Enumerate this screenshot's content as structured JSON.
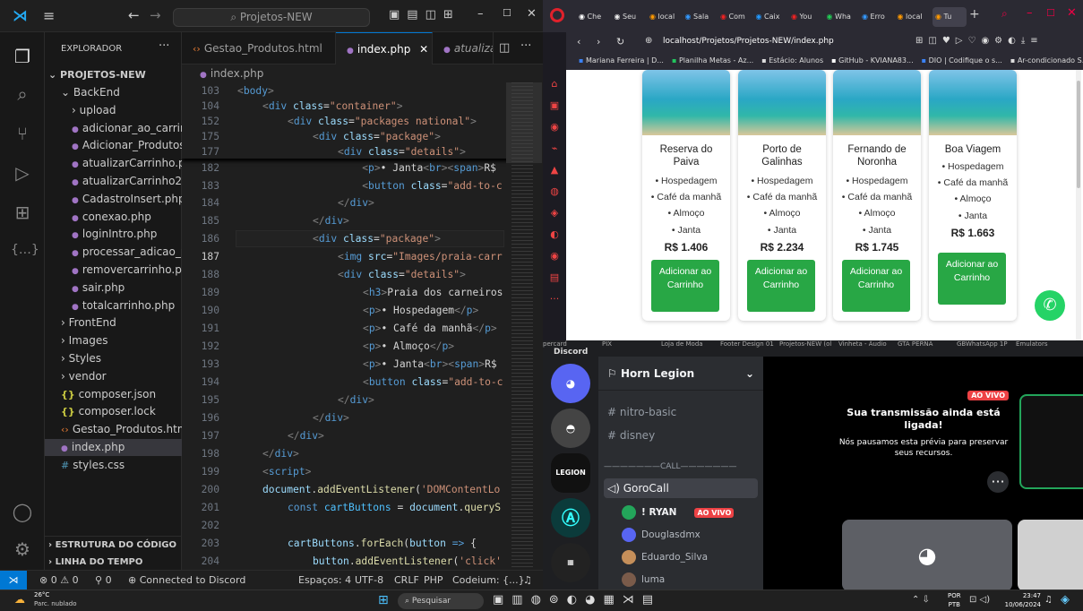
{
  "vscode": {
    "search": "Projetos-NEW",
    "explorer_title": "EXPLORADOR",
    "project": "PROJETOS-NEW",
    "tree": [
      {
        "label": "BackEnd",
        "type": "folder-open",
        "indent": 1
      },
      {
        "label": "upload",
        "type": "folder",
        "indent": 2
      },
      {
        "label": "adicionar_ao_carrinh...",
        "type": "php",
        "indent": 2
      },
      {
        "label": "Adicionar_Produtos....",
        "type": "php",
        "indent": 2
      },
      {
        "label": "atualizarCarrinho.php",
        "type": "php",
        "indent": 2
      },
      {
        "label": "atualizarCarrinho2.p...",
        "type": "php",
        "indent": 2
      },
      {
        "label": "CadastroInsert.php",
        "type": "php",
        "indent": 2
      },
      {
        "label": "conexao.php",
        "type": "php",
        "indent": 2
      },
      {
        "label": "loginIntro.php",
        "type": "php",
        "indent": 2
      },
      {
        "label": "processar_adicao_pr...",
        "type": "php",
        "indent": 2
      },
      {
        "label": "removercarrinho.php",
        "type": "php",
        "indent": 2
      },
      {
        "label": "sair.php",
        "type": "php",
        "indent": 2
      },
      {
        "label": "totalcarrinho.php",
        "type": "php",
        "indent": 2
      },
      {
        "label": "FrontEnd",
        "type": "folder",
        "indent": 1
      },
      {
        "label": "Images",
        "type": "folder",
        "indent": 1
      },
      {
        "label": "Styles",
        "type": "folder",
        "indent": 1
      },
      {
        "label": "vendor",
        "type": "folder",
        "indent": 1
      },
      {
        "label": "composer.json",
        "type": "json",
        "indent": 1
      },
      {
        "label": "composer.lock",
        "type": "json",
        "indent": 1
      },
      {
        "label": "Gestao_Produtos.html",
        "type": "html",
        "indent": 1
      },
      {
        "label": "index.php",
        "type": "php",
        "indent": 1,
        "selected": true
      },
      {
        "label": "styles.css",
        "type": "css",
        "indent": 1
      }
    ],
    "outline": "ESTRUTURA DO CÓDIGO",
    "timeline": "LINHA DO TEMPO",
    "tabs": [
      "Gestao_Produtos.html",
      "index.php",
      "atualiza"
    ],
    "breadcrumb": "index.php",
    "status": {
      "errors": "0",
      "warnings": "0",
      "ports": "0",
      "discord": "Connected to Discord",
      "spaces": "Espaços: 4",
      "encoding": "UTF-8",
      "eol": "CRLF",
      "lang": "PHP",
      "codeium": "Codeium: {...}"
    }
  },
  "browser": {
    "tabs": [
      "Che",
      "Seu",
      "local",
      "Sala",
      "Com",
      "Caix",
      "You",
      "Wha",
      "Erro",
      "local",
      "Tu"
    ],
    "url": "localhost/Projetos/Projetos-NEW/index.php",
    "bookmarks": [
      "Mariana Ferreira | D...",
      "Planilha Metas - Az...",
      "Estácio: Alunos",
      "GitHub - KVIANA83...",
      "DIO | Codifique o s...",
      "Ar-condicionado S..."
    ],
    "cards": [
      {
        "title": "Reserva do Paiva",
        "items": [
          "• Hospedagem",
          "• Café da manhã",
          "• Almoço",
          "• Janta"
        ],
        "price": "R$ 1.406",
        "button": "Adicionar ao Carrinho"
      },
      {
        "title": "Porto de Galinhas",
        "items": [
          "• Hospedagem",
          "• Café da manhã",
          "• Almoço",
          "• Janta"
        ],
        "price": "R$ 2.234",
        "button": "Adicionar ao Carrinho"
      },
      {
        "title": "Fernando de Noronha",
        "items": [
          "• Hospedagem",
          "• Café da manhã",
          "• Almoço",
          "• Janta"
        ],
        "price": "R$ 1.745",
        "button": "Adicionar ao Carrinho"
      },
      {
        "title": "Boa Viagem",
        "items": [
          "• Hospedagem",
          "• Café da manhã",
          "• Almoço",
          "• Janta"
        ],
        "price": "R$ 1.663",
        "button": "Adicionar ao Carrinho"
      }
    ]
  },
  "discord": {
    "app_title": "Discord",
    "top_labels": [
      "percard",
      "PIX",
      "Loja de Moda",
      "Footer Design 01",
      "Projetos-NEW (ol",
      "Vinheta - Áudio",
      "GTA PERNA",
      "GBWhatsApp 1P",
      "Emulators"
    ],
    "server_name": "Horn Legion",
    "channels": [
      "nitro-basic",
      "disney"
    ],
    "call_header": "———————CALL———————",
    "voice_channel": "GoroCall",
    "users": [
      {
        "name": "! RYAN",
        "live": "AO VIVO"
      },
      {
        "name": "Douglasdmx"
      },
      {
        "name": "Eduardo_Silva"
      },
      {
        "name": "luma"
      }
    ],
    "stream": {
      "badge": "AO VIVO",
      "title": "Sua transmissão ainda está ligada!",
      "body": "Nós pausamos esta prévia para preservar seus recursos."
    },
    "server_label": "LEGION"
  },
  "taskbar": {
    "temp": "26°C",
    "weather": "Parc. nublado",
    "search": "Pesquisar",
    "lang1": "POR",
    "lang2": "PTB",
    "time": "23:47",
    "date": "10/06/2024"
  }
}
